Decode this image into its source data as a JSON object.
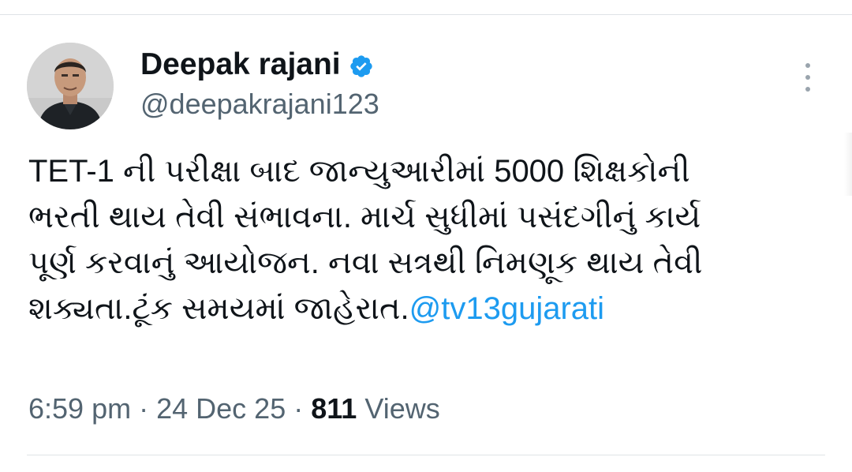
{
  "author": {
    "display_name": "Deepak rajani",
    "handle": "@deepakrajani123",
    "verified": true,
    "avatar_icon": "profile-photo",
    "verified_icon": "verified-badge-icon"
  },
  "tweet": {
    "lines": [
      "TET-1 ની પરીક્ષા બાદ જાન્યુઆરીમાં 5000 શિક્ષકોની",
      "ભરતી  થાય તેવી સંભાવના. માર્ચ સુધીમાં પસંદગીનું કાર્ય",
      "પૂર્ણ કરવાનું આયોજન. નવા સત્રથી નિમણૂક થાય તેવી"
    ],
    "last_line_text": "શક્યતા.ટૂંક સમયમાં જાહેરાત.",
    "mention": "@tv13gujarati"
  },
  "meta": {
    "time": "6:59 pm",
    "separator": "·",
    "date": "24 Dec 25",
    "views_count": "811",
    "views_label": "Views"
  },
  "colors": {
    "text": "#0f1419",
    "secondary": "#536471",
    "link": "#1d9bf0",
    "verified_badge": "#1d9bf0"
  }
}
